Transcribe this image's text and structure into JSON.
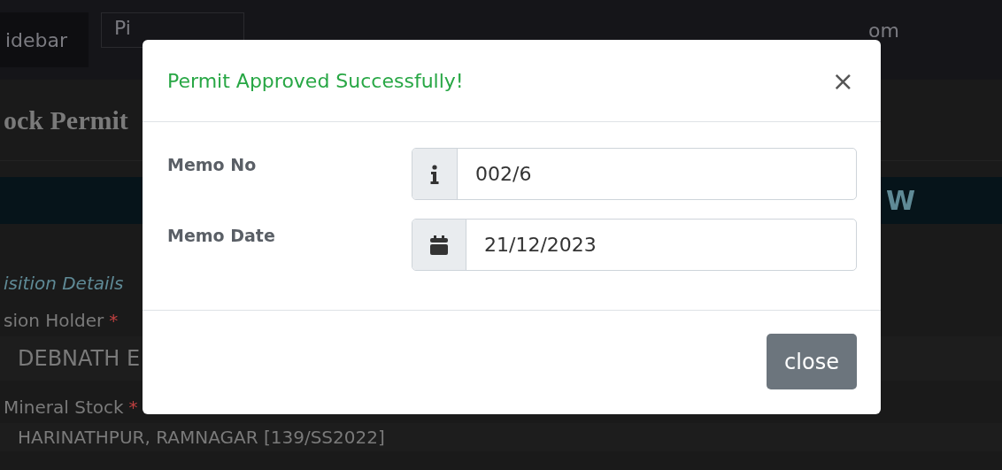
{
  "background": {
    "nav": [
      "idebar",
      "Pi",
      "om"
    ],
    "page_title": "ock Permit",
    "banner": "W",
    "section": "isition Details",
    "fields": [
      {
        "label": "sion Holder",
        "required_mark": "*",
        "value": "DEBNATH E"
      },
      {
        "label": "Mineral Stock",
        "required_mark": "*",
        "value": "HARINATHPUR, RAMNAGAR [139/SS2022]"
      }
    ]
  },
  "modal": {
    "title": "Permit Approved Successfully!",
    "close_icon": "×",
    "fields": [
      {
        "label": "Memo No",
        "kind": "info",
        "value": "002/6"
      },
      {
        "label": "Memo Date",
        "kind": "calendar",
        "value": "21/12/2023"
      }
    ],
    "button": "close"
  }
}
